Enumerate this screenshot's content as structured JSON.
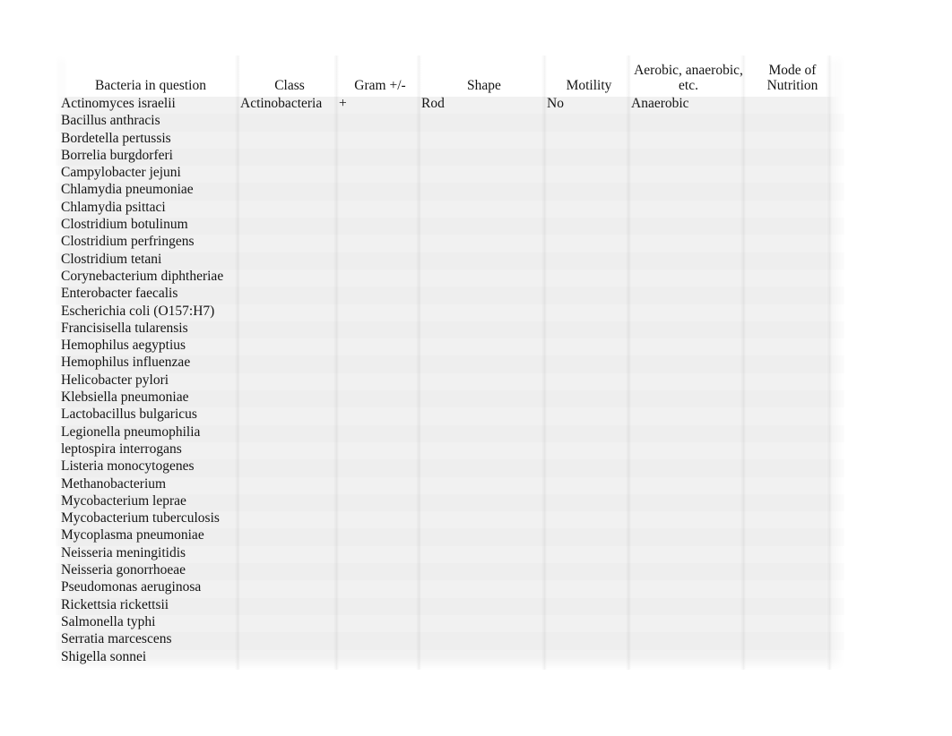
{
  "table": {
    "columns": [
      {
        "key": "bacteria",
        "label": "Bacteria in question",
        "align": "center"
      },
      {
        "key": "class",
        "label": "Class",
        "align": "center"
      },
      {
        "key": "gram",
        "label": "Gram +/-",
        "align": "center"
      },
      {
        "key": "shape",
        "label": "Shape",
        "align": "center"
      },
      {
        "key": "motility",
        "label": "Motility",
        "align": "center"
      },
      {
        "key": "oxygen",
        "label": "Aerobic, anaerobic, etc.",
        "align": "center"
      },
      {
        "key": "nutrition",
        "label": "Mode of Nutrition",
        "align": "center"
      }
    ],
    "header_lines": {
      "bacteria": [
        "Bacteria in question"
      ],
      "class": [
        "Class"
      ],
      "gram": [
        "Gram +/-"
      ],
      "shape": [
        "Shape"
      ],
      "motility": [
        "Motility"
      ],
      "oxygen": [
        "Aerobic, anaerobic,",
        "etc."
      ],
      "nutrition": [
        "Mode of",
        "Nutrition"
      ]
    },
    "rows": [
      {
        "bacteria": "Actinomyces israelii",
        "class": "Actinobacteria",
        "gram": "+",
        "shape": "Rod",
        "motility": "No",
        "oxygen": "Anaerobic",
        "nutrition": ""
      },
      {
        "bacteria": "Bacillus anthracis",
        "class": "",
        "gram": "",
        "shape": "",
        "motility": "",
        "oxygen": "",
        "nutrition": ""
      },
      {
        "bacteria": "Bordetella pertussis",
        "class": "",
        "gram": "",
        "shape": "",
        "motility": "",
        "oxygen": "",
        "nutrition": ""
      },
      {
        "bacteria": "Borrelia burgdorferi",
        "class": "",
        "gram": "",
        "shape": "",
        "motility": "",
        "oxygen": "",
        "nutrition": ""
      },
      {
        "bacteria": "Campylobacter jejuni",
        "class": "",
        "gram": "",
        "shape": "",
        "motility": "",
        "oxygen": "",
        "nutrition": ""
      },
      {
        "bacteria": "Chlamydia pneumoniae",
        "class": "",
        "gram": "",
        "shape": "",
        "motility": "",
        "oxygen": "",
        "nutrition": ""
      },
      {
        "bacteria": "Chlamydia psittaci",
        "class": "",
        "gram": "",
        "shape": "",
        "motility": "",
        "oxygen": "",
        "nutrition": ""
      },
      {
        "bacteria": "Clostridium botulinum",
        "class": "",
        "gram": "",
        "shape": "",
        "motility": "",
        "oxygen": "",
        "nutrition": ""
      },
      {
        "bacteria": "Clostridium perfringens",
        "class": "",
        "gram": "",
        "shape": "",
        "motility": "",
        "oxygen": "",
        "nutrition": ""
      },
      {
        "bacteria": "Clostridium tetani",
        "class": "",
        "gram": "",
        "shape": "",
        "motility": "",
        "oxygen": "",
        "nutrition": ""
      },
      {
        "bacteria": "Corynebacterium diphtheriae",
        "class": "",
        "gram": "",
        "shape": "",
        "motility": "",
        "oxygen": "",
        "nutrition": ""
      },
      {
        "bacteria": "Enterobacter faecalis",
        "class": "",
        "gram": "",
        "shape": "",
        "motility": "",
        "oxygen": "",
        "nutrition": ""
      },
      {
        "bacteria": "Escherichia coli (O157:H7)",
        "class": "",
        "gram": "",
        "shape": "",
        "motility": "",
        "oxygen": "",
        "nutrition": ""
      },
      {
        "bacteria": "Francisisella tularensis",
        "class": "",
        "gram": "",
        "shape": "",
        "motility": "",
        "oxygen": "",
        "nutrition": ""
      },
      {
        "bacteria": "Hemophilus aegyptius",
        "class": "",
        "gram": "",
        "shape": "",
        "motility": "",
        "oxygen": "",
        "nutrition": ""
      },
      {
        "bacteria": "Hemophilus influenzae",
        "class": "",
        "gram": "",
        "shape": "",
        "motility": "",
        "oxygen": "",
        "nutrition": ""
      },
      {
        "bacteria": "Helicobacter pylori",
        "class": "",
        "gram": "",
        "shape": "",
        "motility": "",
        "oxygen": "",
        "nutrition": ""
      },
      {
        "bacteria": "Klebsiella pneumoniae",
        "class": "",
        "gram": "",
        "shape": "",
        "motility": "",
        "oxygen": "",
        "nutrition": ""
      },
      {
        "bacteria": "Lactobacillus bulgaricus",
        "class": "",
        "gram": "",
        "shape": "",
        "motility": "",
        "oxygen": "",
        "nutrition": ""
      },
      {
        "bacteria": "Legionella pneumophilia",
        "class": "",
        "gram": "",
        "shape": "",
        "motility": "",
        "oxygen": "",
        "nutrition": ""
      },
      {
        "bacteria": "leptospira interrogans",
        "class": "",
        "gram": "",
        "shape": "",
        "motility": "",
        "oxygen": "",
        "nutrition": ""
      },
      {
        "bacteria": "Listeria monocytogenes",
        "class": "",
        "gram": "",
        "shape": "",
        "motility": "",
        "oxygen": "",
        "nutrition": ""
      },
      {
        "bacteria": "Methanobacterium",
        "class": "",
        "gram": "",
        "shape": "",
        "motility": "",
        "oxygen": "",
        "nutrition": ""
      },
      {
        "bacteria": "Mycobacterium leprae",
        "class": "",
        "gram": "",
        "shape": "",
        "motility": "",
        "oxygen": "",
        "nutrition": ""
      },
      {
        "bacteria": "Mycobacterium tuberculosis",
        "class": "",
        "gram": "",
        "shape": "",
        "motility": "",
        "oxygen": "",
        "nutrition": ""
      },
      {
        "bacteria": "Mycoplasma pneumoniae",
        "class": "",
        "gram": "",
        "shape": "",
        "motility": "",
        "oxygen": "",
        "nutrition": ""
      },
      {
        "bacteria": "Neisseria meningitidis",
        "class": "",
        "gram": "",
        "shape": "",
        "motility": "",
        "oxygen": "",
        "nutrition": ""
      },
      {
        "bacteria": "Neisseria gonorrhoeae",
        "class": "",
        "gram": "",
        "shape": "",
        "motility": "",
        "oxygen": "",
        "nutrition": ""
      },
      {
        "bacteria": "Pseudomonas aeruginosa",
        "class": "",
        "gram": "",
        "shape": "",
        "motility": "",
        "oxygen": "",
        "nutrition": ""
      },
      {
        "bacteria": "Rickettsia rickettsii",
        "class": "",
        "gram": "",
        "shape": "",
        "motility": "",
        "oxygen": "",
        "nutrition": ""
      },
      {
        "bacteria": "Salmonella typhi",
        "class": "",
        "gram": "",
        "shape": "",
        "motility": "",
        "oxygen": "",
        "nutrition": ""
      },
      {
        "bacteria": "Serratia marcescens",
        "class": "",
        "gram": "",
        "shape": "",
        "motility": "",
        "oxygen": "",
        "nutrition": ""
      },
      {
        "bacteria": "Shigella sonnei",
        "class": "",
        "gram": "",
        "shape": "",
        "motility": "",
        "oxygen": "",
        "nutrition": ""
      }
    ]
  },
  "style": {
    "page_background": "#ffffff",
    "sheet_background": "#f1f1f1",
    "header_background": "#ffffff",
    "text_color": "#141414",
    "separator_color": "rgba(0,0,0,0.05)"
  }
}
